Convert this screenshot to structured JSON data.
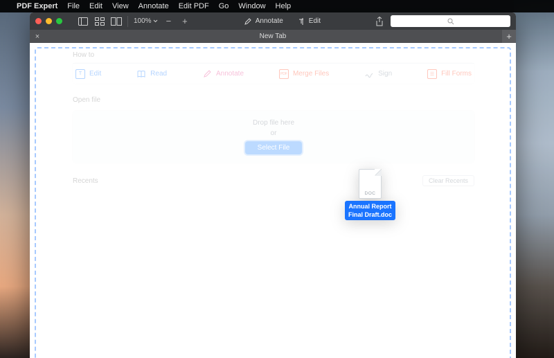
{
  "menubar": {
    "app": "PDF Expert",
    "items": [
      "File",
      "Edit",
      "View",
      "Annotate",
      "Edit PDF",
      "Go",
      "Window",
      "Help"
    ]
  },
  "toolbar": {
    "zoom": "100%",
    "annotate": "Annotate",
    "edit": "Edit"
  },
  "tab": {
    "title": "New Tab"
  },
  "howto": {
    "label": "How to",
    "edit": "Edit",
    "read": "Read",
    "annotate": "Annotate",
    "merge": "Merge Files",
    "sign": "Sign",
    "fill": "Fill Forms"
  },
  "openfile": {
    "label": "Open file",
    "drop": "Drop file here",
    "or": "or",
    "select": "Select File"
  },
  "recents": {
    "label": "Recents",
    "clear": "Clear Recents"
  },
  "dragfile": {
    "ext": "DOC",
    "name": "Annual Report\nFinal Draft.doc"
  }
}
